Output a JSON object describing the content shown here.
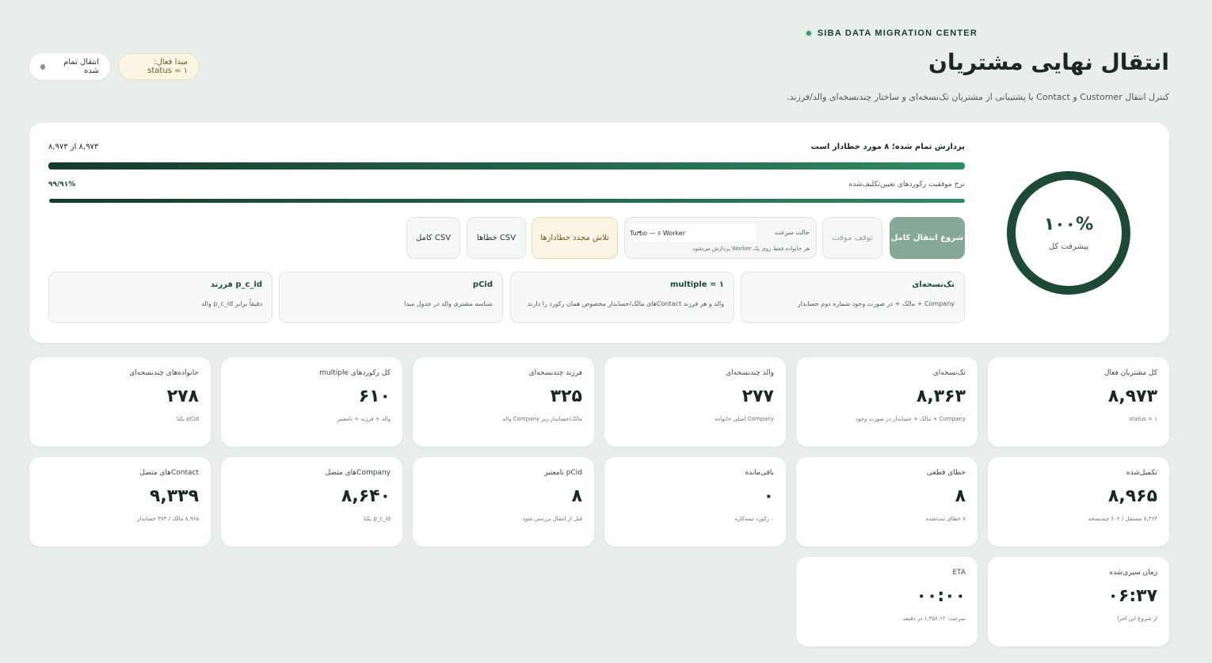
{
  "header": {
    "brand": "SIBA DATA MIGRATION CENTER",
    "title": "انتقال نهایی مشتریان",
    "subtitle": "کنترل انتقال Customer و Contact با پشتیبانی از مشتریان تک‌نسخه‌ای و ساختار چندنسخه‌ای والد/فرزند.",
    "status_pill": "انتقال تمام شده",
    "source_pill": "مبدا فعال: status = ۱"
  },
  "overview": {
    "percent": "۱۰۰%",
    "percent_label": "پیشرفت کل",
    "progress_text": "پردازش تمام شده؛ ۸ مورد خطادار است",
    "progress_count": "۸,۹۷۳ از ۸,۹۷۳",
    "progress_fraction": 1.0,
    "success_text": "نرخ موفقیت رکوردهای تعیین‌تکلیف‌شده",
    "success_rate": "۹۹/۹۱%",
    "success_fraction": 0.9991
  },
  "controls": {
    "start_label": "شروع انتقال کامل",
    "pause_label": "توقف موقت",
    "speed_label": "حالت سرعت",
    "speed_value": "Turbo — ۶ Worker",
    "speed_hint": "هر خانواده فقط روی یک Worker پردازش می‌شود",
    "retry_label": "تلاش مجدد خطادارها",
    "error_csv_label": "CSV خطاها",
    "full_csv_label": "CSV کامل"
  },
  "info_cards": [
    {
      "title": "تک‌نسخه‌ای",
      "desc": "Company + مالک + در صورت وجود شماره دوم حسابدار"
    },
    {
      "title": "multiple = ۱",
      "desc": "والد و هر فرزند Contactهای مالک/حسابدار مخصوص همان رکورد را دارند"
    },
    {
      "title": "pCid",
      "desc": "شناسه مشتری والد در جدول مبدا"
    },
    {
      "title": "p_c_id فرزند",
      "desc": "دقیقاً برابر p_c_id والد"
    }
  ],
  "stats": [
    {
      "label": "کل مشتریان فعال",
      "value": "۸,۹۷۳",
      "sub": "status = ۱"
    },
    {
      "label": "تک‌نسخه‌ای",
      "value": "۸,۳۶۳",
      "sub": "Company + مالک + حسابدار در صورت وجود"
    },
    {
      "label": "والد چندنسخه‌ای",
      "value": "۲۷۷",
      "sub": "Company اصلی خانواده"
    },
    {
      "label": "فرزند چندنسخه‌ای",
      "value": "۳۲۵",
      "sub": "مالک/حسابدار زیر Company والد"
    },
    {
      "label": "کل رکوردهای multiple",
      "value": "۶۱۰",
      "sub": "والد + فرزند + نامعتبر"
    },
    {
      "label": "خانواده‌های چندنسخه‌ای",
      "value": "۲۷۸",
      "sub": "pCid یکتا"
    },
    {
      "label": "تکمیل‌شده",
      "value": "۸,۹۶۵",
      "sub": "۸,۳۶۳ مستقل / ۶۰۲ چندنسخه"
    },
    {
      "label": "خطای قطعی",
      "value": "۸",
      "sub": "۸ خطای ثبت‌شده"
    },
    {
      "label": "باقی‌مانده",
      "value": "۰",
      "sub": "۰ رکورد نیمه‌کاره"
    },
    {
      "label": "pCid نامعتبر",
      "value": "۸",
      "sub": "قبل از انتقال بررسی شود"
    },
    {
      "label": "Companyهای متصل",
      "value": "۸,۶۴۰",
      "sub": "p_c_id یکتا"
    },
    {
      "label": "Contactهای متصل",
      "value": "۹,۳۳۹",
      "sub": "۸,۹۶۵ مالک / ۳۷۴ حسابدار"
    },
    {
      "label": "زمان سپری‌شده",
      "value": "۰۶:۳۷",
      "sub": "از شروع این اجرا"
    },
    {
      "label": "ETA",
      "value": "۰۰:۰۰",
      "sub": "سرعت: ۱,۳۵۶.۱۲ در دقیقه"
    }
  ],
  "colors": {
    "accent": "#1d4a36",
    "accent_light": "#2e8a63",
    "start_button": "#86a898",
    "warning_bg": "#fbf4e3",
    "background": "#e8eeea"
  }
}
